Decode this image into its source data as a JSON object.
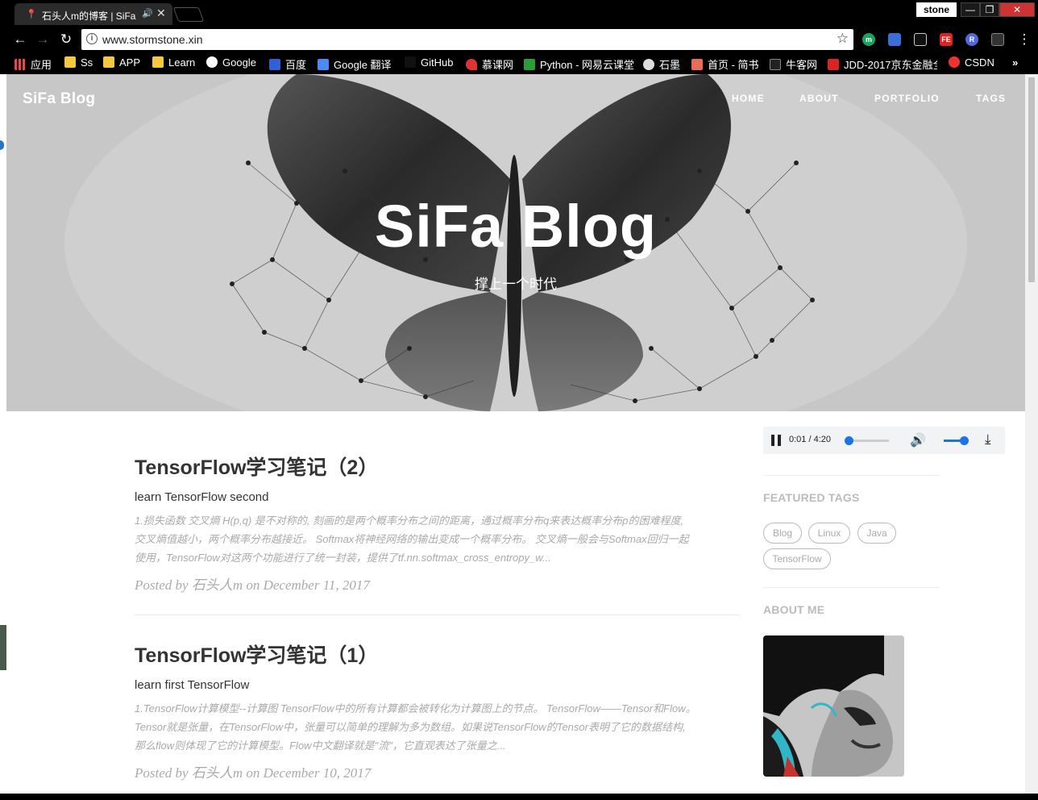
{
  "browser": {
    "tab_title": "石头人m的博客 | SiFa",
    "profile_name": "stone",
    "url": "www.stormstone.xin",
    "bookmarks": [
      "应用",
      "Ss",
      "APP",
      "Learn",
      "Google",
      "百度",
      "Google 翻译",
      "GitHub",
      "慕课网",
      "Python - 网易云课堂",
      "石墨",
      "首页 - 简书",
      "牛客网",
      "JDD-2017京东金融全",
      "CSDN"
    ],
    "bookmarks_overflow": "»",
    "extensions": [
      "m",
      "FE",
      "R"
    ]
  },
  "site": {
    "brand": "SiFa Blog",
    "nav": [
      "HOME",
      "ABOUT",
      "PORTFOLIO",
      "TAGS"
    ],
    "hero_title": "SiFa Blog",
    "hero_subtitle": "撑上一个时代"
  },
  "posts": [
    {
      "title": "TensorFlow学习笔记（2）",
      "subtitle": "learn TensorFlow second",
      "excerpt_lines": [
        "1.损失函数  交叉熵 H(p,q) 是不对称的, 刻画的是两个概率分布之间的距离，通过概率分布q来表达概率分布p的困难程度,",
        "交叉熵值越小，两个概率分布越接近。  Softmax将神经网络的输出变成一个概率分布。  交叉熵一般会与Softmax回归一起",
        "使用，TensorFlow对这两个功能进行了统一封装，提供了tf.nn.softmax_cross_entropy_w..."
      ],
      "meta": "Posted by  石头人m on December 11, 2017"
    },
    {
      "title": "TensorFlow学习笔记（1）",
      "subtitle": "learn first TensorFlow",
      "excerpt_lines": [
        "1.TensorFlow计算模型--计算图  TensorFlow中的所有计算都会被转化为计算图上的节点。  TensorFlow——Tensor和Flow。",
        "Tensor就是张量，在TensorFlow中，张量可以简单的理解为多为数组。如果说TensorFlow的Tensor表明了它的数据结构,",
        "那么flow则体现了它的计算模型。Flow中文翻译就是\"流\"，它直观表达了张量之..."
      ],
      "meta": "Posted by  石头人m on December 10, 2017"
    }
  ],
  "sidebar": {
    "audio": {
      "time": "0:01 / 4:20",
      "progress": 0.004,
      "volume": 1.0
    },
    "featured_tags_heading": "FEATURED TAGS",
    "tags": [
      "Blog",
      "Linux",
      "Java",
      "TensorFlow"
    ],
    "about_heading": "ABOUT ME"
  },
  "colors": {
    "accent": "#1a73e8",
    "hero_bg": "#c8c8c8",
    "muted": "#aaaaaa"
  }
}
